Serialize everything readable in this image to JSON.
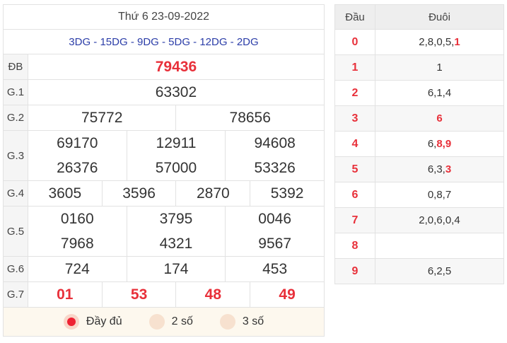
{
  "title": "Thứ 6 23-09-2022",
  "codes": "3DG - 15DG - 9DG - 5DG - 12DG - 2DG",
  "labels": {
    "db": "ĐB",
    "g1": "G.1",
    "g2": "G.2",
    "g3": "G.3",
    "g4": "G.4",
    "g5": "G.5",
    "g6": "G.6",
    "g7": "G.7"
  },
  "prizes": {
    "db": "79436",
    "g1": "63302",
    "g2": [
      "75772",
      "78656"
    ],
    "g3": [
      "69170",
      "12911",
      "94608",
      "26376",
      "57000",
      "53326"
    ],
    "g4": [
      "3605",
      "3596",
      "2870",
      "5392"
    ],
    "g5": [
      "0160",
      "3795",
      "0046",
      "7968",
      "4321",
      "9567"
    ],
    "g6": [
      "724",
      "174",
      "453"
    ],
    "g7": [
      "01",
      "53",
      "48",
      "49"
    ]
  },
  "options": {
    "full": "Đầy đủ",
    "two": "2 số",
    "three": "3 số",
    "selected": "full"
  },
  "dau_duoi": {
    "header_dau": "Đầu",
    "header_duoi": "Đuôi",
    "rows": [
      {
        "dau": "0",
        "normal": "2,8,0,5,",
        "bold": "1"
      },
      {
        "dau": "1",
        "normal": "1",
        "bold": ""
      },
      {
        "dau": "2",
        "normal": "6,1,4",
        "bold": ""
      },
      {
        "dau": "3",
        "normal": "",
        "bold": "6"
      },
      {
        "dau": "4",
        "normal": "6,",
        "bold": "8,9"
      },
      {
        "dau": "5",
        "normal": "6,3,",
        "bold": "3"
      },
      {
        "dau": "6",
        "normal": "0,8,7",
        "bold": ""
      },
      {
        "dau": "7",
        "normal": "2,0,6,0,4",
        "bold": ""
      },
      {
        "dau": "8",
        "normal": "",
        "bold": ""
      },
      {
        "dau": "9",
        "normal": "6,2,5",
        "bold": ""
      }
    ]
  },
  "colors": {
    "accent_red": "#e8303a",
    "code_blue": "#2b3da8",
    "option_bg": "#fdf8ee"
  }
}
